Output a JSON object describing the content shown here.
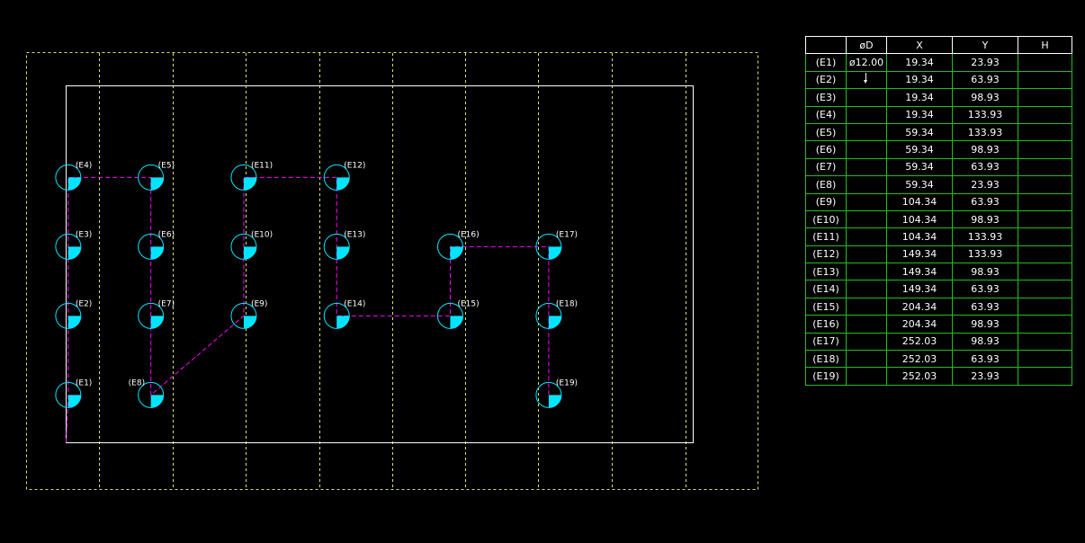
{
  "table": {
    "headers": [
      "",
      "øD",
      "X",
      "Y",
      "H"
    ],
    "rows": [
      {
        "id": "(E1)",
        "dia": "ø12.00",
        "x": "19.34",
        "y": "23.93",
        "h": ""
      },
      {
        "id": "(E2)",
        "dia": "",
        "x": "19.34",
        "y": "63.93",
        "h": ""
      },
      {
        "id": "(E3)",
        "dia": "",
        "x": "19.34",
        "y": "98.93",
        "h": ""
      },
      {
        "id": "(E4)",
        "dia": "",
        "x": "19.34",
        "y": "133.93",
        "h": ""
      },
      {
        "id": "(E5)",
        "dia": "",
        "x": "59.34",
        "y": "133.93",
        "h": ""
      },
      {
        "id": "(E6)",
        "dia": "",
        "x": "59.34",
        "y": "98.93",
        "h": ""
      },
      {
        "id": "(E7)",
        "dia": "",
        "x": "59.34",
        "y": "63.93",
        "h": ""
      },
      {
        "id": "(E8)",
        "dia": "",
        "x": "59.34",
        "y": "23.93",
        "h": ""
      },
      {
        "id": "(E9)",
        "dia": "",
        "x": "104.34",
        "y": "63.93",
        "h": ""
      },
      {
        "id": "(E10)",
        "dia": "",
        "x": "104.34",
        "y": "98.93",
        "h": ""
      },
      {
        "id": "(E11)",
        "dia": "",
        "x": "104.34",
        "y": "133.93",
        "h": ""
      },
      {
        "id": "(E12)",
        "dia": "",
        "x": "149.34",
        "y": "133.93",
        "h": ""
      },
      {
        "id": "(E13)",
        "dia": "",
        "x": "149.34",
        "y": "98.93",
        "h": ""
      },
      {
        "id": "(E14)",
        "dia": "",
        "x": "149.34",
        "y": "63.93",
        "h": ""
      },
      {
        "id": "(E15)",
        "dia": "",
        "x": "204.34",
        "y": "63.93",
        "h": ""
      },
      {
        "id": "(E16)",
        "dia": "",
        "x": "204.34",
        "y": "98.93",
        "h": ""
      },
      {
        "id": "(E17)",
        "dia": "",
        "x": "252.03",
        "y": "98.93",
        "h": ""
      },
      {
        "id": "(E18)",
        "dia": "",
        "x": "252.03",
        "y": "63.93",
        "h": ""
      },
      {
        "id": "(E19)",
        "dia": "",
        "x": "252.03",
        "y": "23.93",
        "h": ""
      }
    ]
  },
  "path_order": [
    "(E1)",
    "(E2)",
    "(E3)",
    "(E4)",
    "(E5)",
    "(E6)",
    "(E7)",
    "(E8)",
    "(E9)",
    "(E10)",
    "(E11)",
    "(E12)",
    "(E13)",
    "(E14)",
    "(E15)",
    "(E16)",
    "(E17)",
    "(E18)",
    "(E19)"
  ],
  "colors": {
    "background": "#000000",
    "hole": "#00e5ff",
    "toolpath": "#ff00ff",
    "outline": "#ffffff",
    "sheet": "#e0e070",
    "table_grid": "#1fbf1f",
    "label": "#ffffff"
  }
}
